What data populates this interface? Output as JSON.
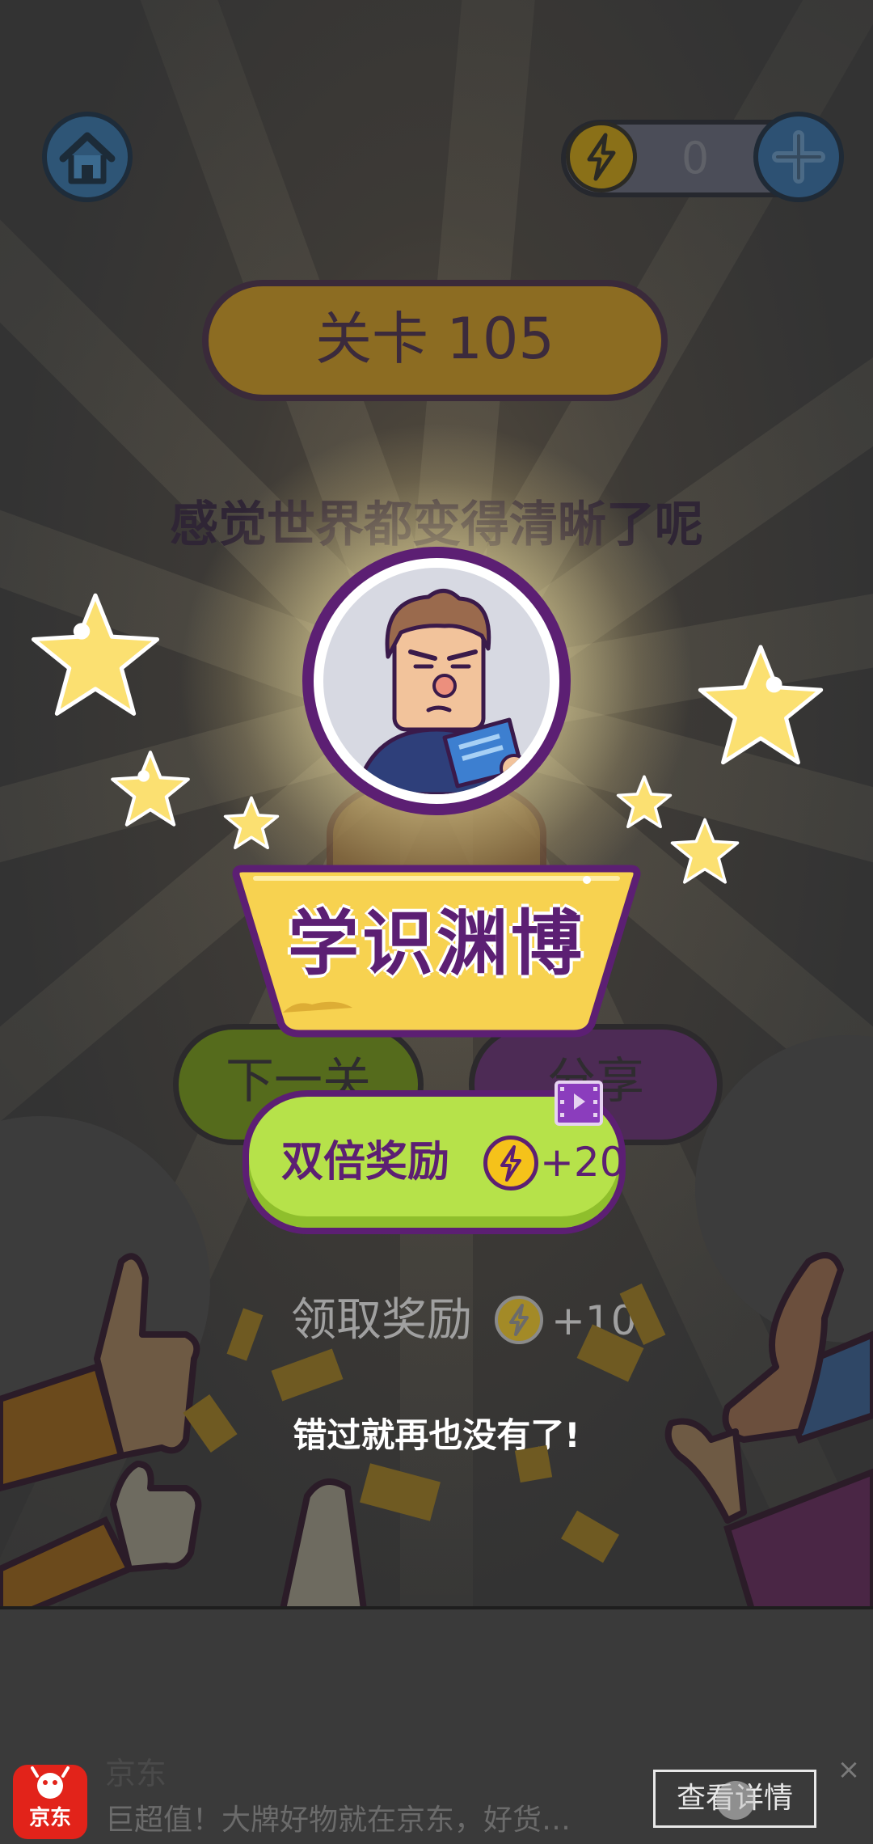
{
  "topbar": {
    "home_icon": "home-icon",
    "energy_icon": "lightning-icon",
    "energy_count": "0",
    "add_icon": "plus-icon"
  },
  "level": {
    "title": "关卡 105",
    "subtitle": "感觉世界都变得清晰了呢"
  },
  "reward_popup": {
    "avatar_icon": "scholar-reading-avatar",
    "badge_label": "学识渊博",
    "double_reward": {
      "label": "双倍奖励",
      "amount": "+20",
      "icon": "lightning-icon",
      "video_icon": "video-icon"
    },
    "claim_reward": {
      "label": "领取奖励",
      "amount": "+10",
      "icon": "lightning-icon"
    },
    "hint": "错过就再也没有了!"
  },
  "background_buttons": {
    "next": "下一关",
    "share": "分享"
  },
  "ad": {
    "brand": "京东",
    "logo_text": "京东",
    "title": "京东",
    "description": "巨超值！大牌好物就在京东，好货…",
    "cta": "查看详情",
    "close": "×"
  },
  "colors": {
    "accent_purple": "#5c1f73",
    "lime": "#b6e24a",
    "gold": "#f5c21a",
    "badge_yellow": "#f7d250"
  }
}
